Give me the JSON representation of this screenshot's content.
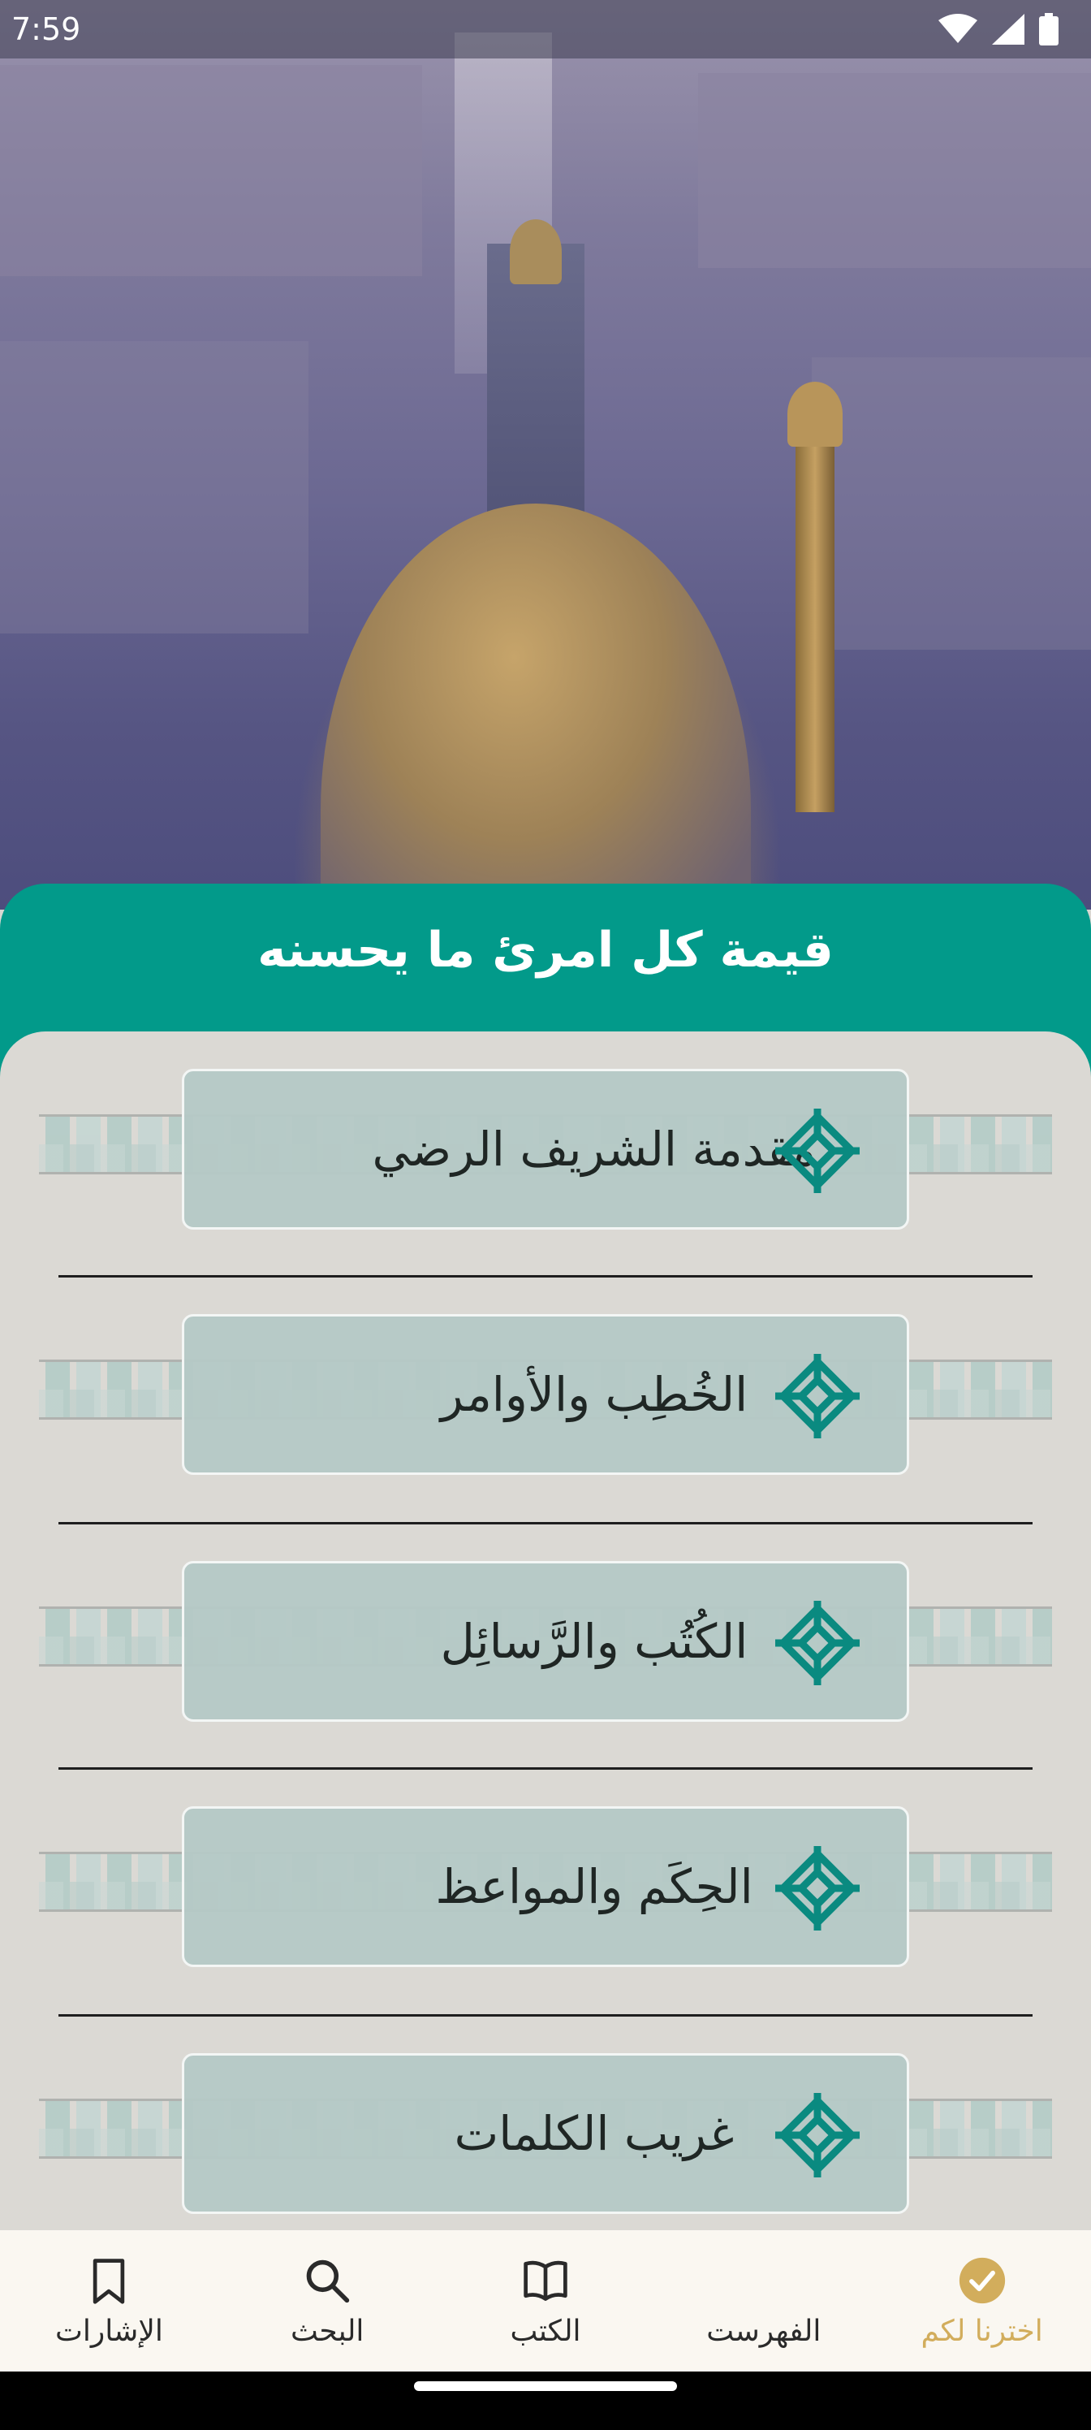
{
  "status_bar": {
    "time": "7:59",
    "icons": [
      "wifi-icon",
      "signal-icon",
      "battery-icon"
    ]
  },
  "header": {
    "title": "قيمة كل امرئ ما يحسنه"
  },
  "items": [
    {
      "label": "مقدمة الشريف الرضي",
      "icon": "knot-ornament-icon"
    },
    {
      "label": "الخُطِب والأوامر",
      "icon": "knot-ornament-icon"
    },
    {
      "label": "الكُتُب والرَّسائِل",
      "icon": "knot-ornament-icon"
    },
    {
      "label": "الحِكَم والمواعظ",
      "icon": "knot-ornament-icon"
    },
    {
      "label": "غريب الكلمات",
      "icon": "knot-ornament-icon"
    }
  ],
  "bottom_nav": [
    {
      "label": "اخترنا لكم",
      "icon": "check-circle-icon",
      "active": true
    },
    {
      "label": "الفهرست",
      "icon": "",
      "active": false
    },
    {
      "label": "الكتب",
      "icon": "open-book-icon",
      "active": false
    },
    {
      "label": "البحث",
      "icon": "search-icon",
      "active": false
    },
    {
      "label": "الإشارات",
      "icon": "bookmark-icon",
      "active": false
    }
  ],
  "colors": {
    "teal": "#029a8a",
    "gold": "#d2ad5c",
    "card": "#b5c9c6",
    "background": "#dbd9d4"
  }
}
